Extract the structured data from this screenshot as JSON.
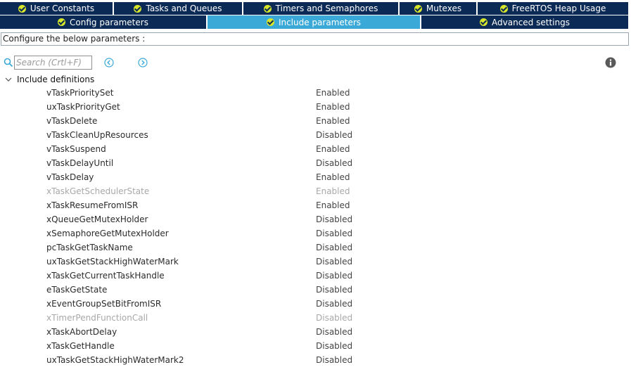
{
  "tabs_row1": [
    {
      "label": "User Constants",
      "width": 160
    },
    {
      "label": "Tasks and Queues",
      "width": 182
    },
    {
      "label": "Timers and Semaphores",
      "width": 220
    },
    {
      "label": "Mutexes",
      "width": 109
    },
    {
      "label": "FreeRTOS Heap Usage",
      "width": 214
    }
  ],
  "tabs_row2": [
    {
      "label": "Config parameters",
      "width": 293
    },
    {
      "label": "Include parameters",
      "width": 302,
      "active": true
    },
    {
      "label": "Advanced settings",
      "width": 294
    }
  ],
  "configure_text": "Configure the below parameters :",
  "search": {
    "placeholder": "Search (Crtl+F)",
    "value": ""
  },
  "icons": {
    "search": "search-icon",
    "prev": "circle-chevron-left-icon",
    "next": "circle-chevron-right-icon",
    "info": "info-icon",
    "tab_check": "check-circle-icon",
    "group_toggle": "chevron-down-icon"
  },
  "colors": {
    "tab_bg": "#0b2a56",
    "tab_active_bg": "#3aa9d8",
    "check": "#d8e629",
    "nav_icon": "#3aa9d8",
    "disabled_text": "#a8a8a8"
  },
  "group": {
    "label": "Include definitions",
    "expanded": true
  },
  "params": [
    {
      "name": "vTaskPrioritySet",
      "value": "Enabled",
      "greyed": false
    },
    {
      "name": "uxTaskPriorityGet",
      "value": "Enabled",
      "greyed": false
    },
    {
      "name": "vTaskDelete",
      "value": "Enabled",
      "greyed": false
    },
    {
      "name": "vTaskCleanUpResources",
      "value": "Disabled",
      "greyed": false
    },
    {
      "name": "vTaskSuspend",
      "value": "Enabled",
      "greyed": false
    },
    {
      "name": "vTaskDelayUntil",
      "value": "Disabled",
      "greyed": false
    },
    {
      "name": "vTaskDelay",
      "value": "Enabled",
      "greyed": false
    },
    {
      "name": "xTaskGetSchedulerState",
      "value": "Enabled",
      "greyed": true
    },
    {
      "name": "xTaskResumeFromISR",
      "value": "Enabled",
      "greyed": false
    },
    {
      "name": "xQueueGetMutexHolder",
      "value": "Disabled",
      "greyed": false
    },
    {
      "name": "xSemaphoreGetMutexHolder",
      "value": "Disabled",
      "greyed": false
    },
    {
      "name": "pcTaskGetTaskName",
      "value": "Disabled",
      "greyed": false
    },
    {
      "name": "uxTaskGetStackHighWaterMark",
      "value": "Disabled",
      "greyed": false
    },
    {
      "name": "xTaskGetCurrentTaskHandle",
      "value": "Disabled",
      "greyed": false
    },
    {
      "name": "eTaskGetState",
      "value": "Disabled",
      "greyed": false
    },
    {
      "name": "xEventGroupSetBitFromISR",
      "value": "Disabled",
      "greyed": false
    },
    {
      "name": "xTimerPendFunctionCall",
      "value": "Disabled",
      "greyed": true
    },
    {
      "name": "xTaskAbortDelay",
      "value": "Disabled",
      "greyed": false
    },
    {
      "name": "xTaskGetHandle",
      "value": "Disabled",
      "greyed": false
    },
    {
      "name": "uxTaskGetStackHighWaterMark2",
      "value": "Disabled",
      "greyed": false
    }
  ]
}
